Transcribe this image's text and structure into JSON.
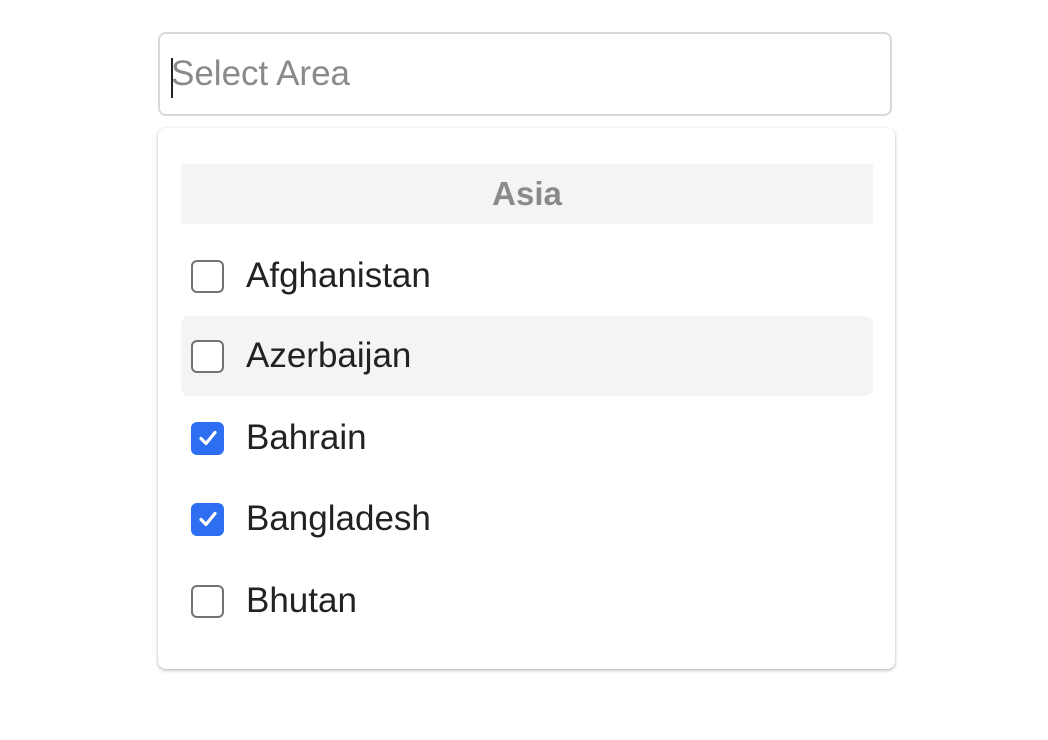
{
  "search": {
    "placeholder": "Select Area",
    "value": ""
  },
  "dropdown": {
    "group_label": "Asia",
    "options": [
      {
        "label": "Afghanistan",
        "checked": false,
        "hovered": false
      },
      {
        "label": "Azerbaijan",
        "checked": false,
        "hovered": true
      },
      {
        "label": "Bahrain",
        "checked": true,
        "hovered": false
      },
      {
        "label": "Bangladesh",
        "checked": true,
        "hovered": false
      },
      {
        "label": "Bhutan",
        "checked": false,
        "hovered": false
      }
    ]
  },
  "colors": {
    "accent": "#2e6ff2",
    "hover_bg": "#f4f4f4",
    "group_header_text": "#8a8a8a",
    "text": "#222222"
  }
}
